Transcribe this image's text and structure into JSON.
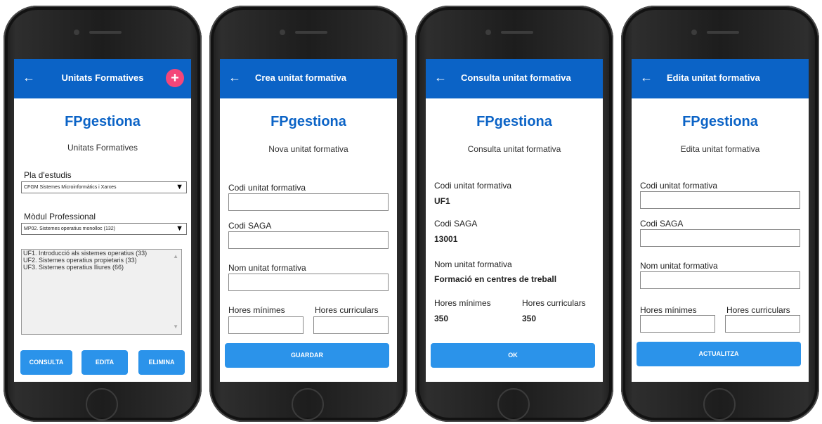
{
  "screens": {
    "list": {
      "title": "Unitats Formatives",
      "add_symbol": "+",
      "brand": "FPgestiona",
      "subtitle": "Unitats Formatives",
      "plan_label": "Pla d'estudis",
      "plan_value": "CFGM Sistemes Microinformàtics i Xarxes",
      "module_label": "Mòdul Professional",
      "module_value": "MP02. Sistemes operatius monolloc (132)",
      "items": [
        "UF1. Introducció als sistemes operatius (33)",
        "UF2. Sistemes operatius propietaris (33)",
        "UF3. Sistemes operatius lliures (66)"
      ],
      "btn_consulta": "CONSULTA",
      "btn_edita": "EDITA",
      "btn_elimina": "ELIMINA"
    },
    "create": {
      "title": "Crea unitat formativa",
      "brand": "FPgestiona",
      "subtitle": "Nova unitat formativa",
      "code_label": "Codi unitat formativa",
      "saga_label": "Codi SAGA",
      "name_label": "Nom unitat formativa",
      "min_label": "Hores mínimes",
      "cur_label": "Hores curriculars",
      "button": "GUARDAR"
    },
    "view": {
      "title": "Consulta unitat formativa",
      "brand": "FPgestiona",
      "subtitle": "Consulta unitat formativa",
      "code_label": "Codi unitat formativa",
      "code_value": "UF1",
      "saga_label": "Codi SAGA",
      "saga_value": "13001",
      "name_label": "Nom unitat formativa",
      "name_value": "Formació en centres de treball",
      "min_label": "Hores mínimes",
      "min_value": "350",
      "cur_label": "Hores curriculars",
      "cur_value": "350",
      "button": "OK"
    },
    "edit": {
      "title": "Edita unitat formativa",
      "brand": "FPgestiona",
      "subtitle": "Edita unitat formativa",
      "code_label": "Codi unitat formativa",
      "saga_label": "Codi SAGA",
      "name_label": "Nom unitat formativa",
      "min_label": "Hores mínimes",
      "cur_label": "Hores curriculars",
      "button": "ACTUALITZA"
    }
  },
  "icons": {
    "back": "arrow-left-icon",
    "add": "plus-circle-icon",
    "dropdown": "caret-down-icon"
  },
  "colors": {
    "appbar": "#0b63c6",
    "brand": "#0b63c6",
    "button": "#2b93ea",
    "add_button": "#f44679"
  }
}
